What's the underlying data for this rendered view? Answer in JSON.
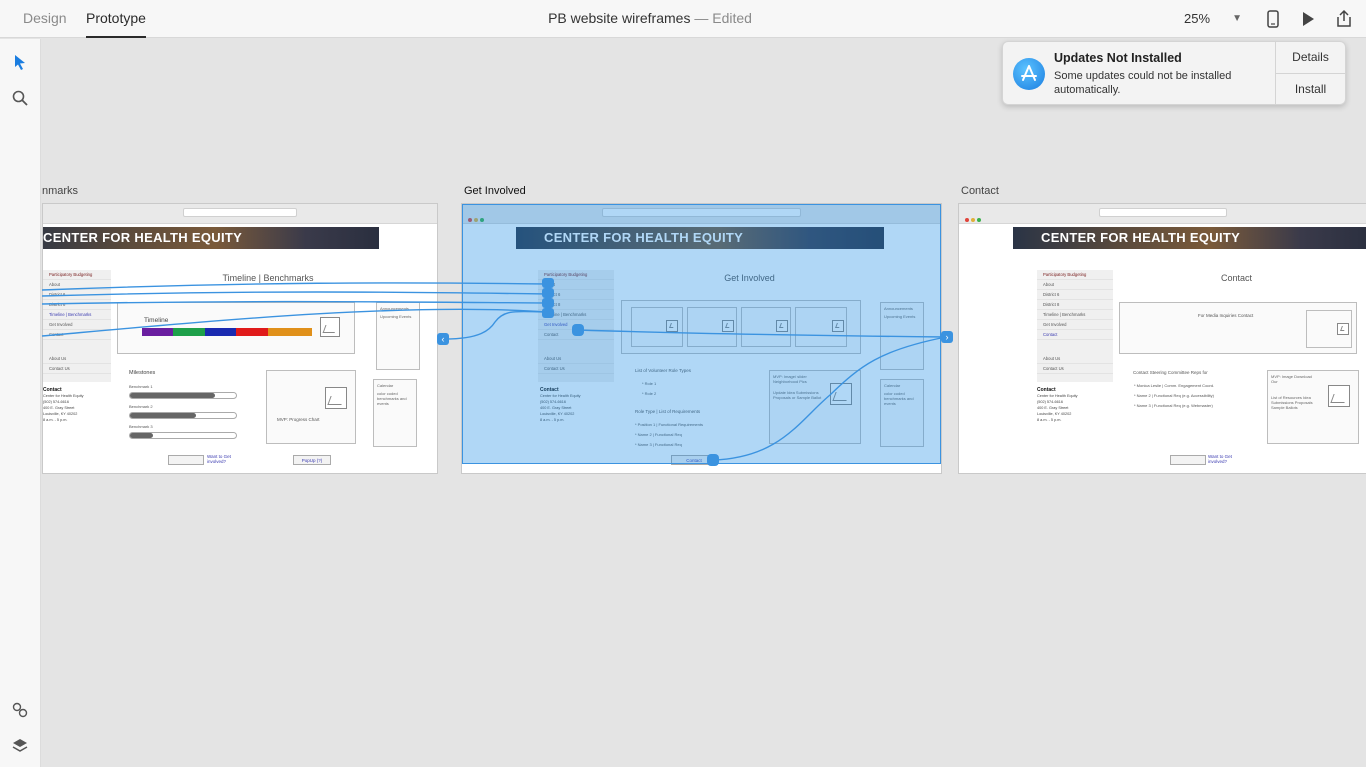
{
  "topbar": {
    "tabs": [
      {
        "label": "Design"
      },
      {
        "label": "Prototype"
      }
    ],
    "doc_title": "PB website wireframes",
    "doc_sep": "—",
    "doc_status": "Edited",
    "zoom": "25%"
  },
  "notification": {
    "title": "Updates Not Installed",
    "body": "Some updates could not be installed automatically.",
    "details": "Details",
    "install": "Install"
  },
  "artboards": {
    "left": {
      "label": "nmarks",
      "hero": "CENTER FOR HEALTH EQUITY",
      "page_title": "Timeline | Benchmarks",
      "sidebar": [
        "Participatory Budgeting",
        "About",
        "District 6",
        "District 8",
        "Timeline | Benchmarks",
        "Get Involved",
        "Contact"
      ],
      "timeline_label": "Timeline",
      "milestones_label": "Milestones",
      "bench1": "Benchmark 1",
      "bench2": "Benchmark 2",
      "bench3": "Benchmark 3",
      "progress": "MVP: Progress Chart",
      "announce": "Announcements",
      "upcoming": "Upcoming Events",
      "calendar": "Calendar",
      "calendar_note": "color coded benchmarks and events",
      "about_us": "About Us",
      "contact_us": "Contact Us",
      "contact": "Contact",
      "contact_lines": [
        "Center for Health Equity",
        "(502) 574-6616",
        "400 E. Gray Street",
        "Louisville, KY 40202",
        "8 a.m. - 5 p.m."
      ],
      "want": "Want to Get involved?",
      "popup": "PopUp (?)"
    },
    "center": {
      "label": "Get Involved",
      "hero": "CENTER FOR HEALTH EQUITY",
      "page_title": "Get Involved",
      "sidebar": [
        "Participatory Budgeting",
        "About",
        "District 6",
        "District 8",
        "Timeline | Benchmarks",
        "Get Involved",
        "Contact"
      ],
      "list_title": "List of Volunteer Role Types",
      "role1": "* Role 1",
      "role2": "* Role 2",
      "role_type": "Role Type | List of Requirements",
      "position1": "* Position 1 | Functional Requirements",
      "name2": "* Name 2 | Functional Req",
      "name3": "* Name 3 | Functional Req",
      "mvp": "MVP: Image/ slider Neighborhood Pics",
      "update": "Update Idea Submissions Proposals or Sample Ballot",
      "announce": "Announcements",
      "upcoming": "Upcoming Events",
      "calendar": "Calendar",
      "calendar_note": "color coded benchmarks and events",
      "about_us": "About Us",
      "contact_us": "Contact Us",
      "contact": "Contact",
      "contact_lines": [
        "Center for Health Equity",
        "(502) 574-6616",
        "400 E. Gray Street",
        "Louisville, KY 40202",
        "8 a.m. - 5 p.m."
      ],
      "contact_btn": "Contact"
    },
    "right": {
      "label": "Contact",
      "hero": "CENTER FOR HEALTH EQUITY",
      "page_title": "Contact",
      "sidebar": [
        "Participatory Budgeting",
        "About",
        "District 6",
        "District 8",
        "Timeline | Benchmarks",
        "Get Involved",
        "Contact"
      ],
      "media": "For Media Inquiries Contact",
      "steering": "Contact Steering Committee Reps for",
      "rep1": "* Monica Leslie | Comm. Engagement Coord.",
      "rep2": "* Name 2 | Functional Req (e.g. Accessibility)",
      "rep3": "* Name 3 | Functional Req (e.g. Webmaster)",
      "mvp": "MVP: Image Download Our",
      "resources": "List of Resources Idea Submissions Proposals Sample Ballots",
      "about_us": "About Us",
      "contact_us": "Contact Us",
      "contact": "Contact",
      "contact_lines": [
        "Center for Health Equity",
        "(502) 574-6616",
        "400 E. Gray Street",
        "Louisville, KY 40202",
        "8 a.m. - 5 p.m."
      ],
      "want": "Want to Get involved?"
    }
  },
  "colors": {
    "accent": "#3b93e0",
    "selection": "#1e8ce6"
  }
}
